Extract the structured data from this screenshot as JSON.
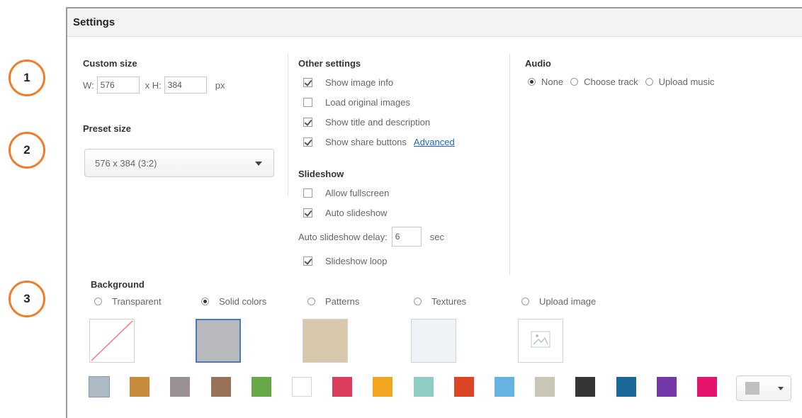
{
  "callouts": [
    "1",
    "2",
    "3"
  ],
  "panel": {
    "title": "Settings"
  },
  "custom_size": {
    "title": "Custom size",
    "w_label": "W:",
    "w_value": "576",
    "h_label": "x H:",
    "h_value": "384",
    "unit": "px"
  },
  "preset_size": {
    "title": "Preset size",
    "selected": "576 x 384 (3:2)"
  },
  "other_settings": {
    "title": "Other settings",
    "items": [
      {
        "label": "Show image info",
        "checked": true
      },
      {
        "label": "Load original images",
        "checked": false
      },
      {
        "label": "Show title and description",
        "checked": true
      },
      {
        "label": "Show share buttons",
        "checked": true
      }
    ],
    "advanced_link": "Advanced"
  },
  "slideshow": {
    "title": "Slideshow",
    "items": [
      {
        "label": "Allow fullscreen",
        "checked": false
      },
      {
        "label": "Auto slideshow",
        "checked": true
      }
    ],
    "delay_label": "Auto slideshow delay:",
    "delay_value": "6",
    "delay_unit": "sec",
    "loop": {
      "label": "Slideshow loop",
      "checked": true
    }
  },
  "audio": {
    "title": "Audio",
    "options": [
      {
        "label": "None",
        "selected": true
      },
      {
        "label": "Choose track",
        "selected": false
      },
      {
        "label": "Upload music",
        "selected": false
      }
    ]
  },
  "background": {
    "title": "Background",
    "options": [
      {
        "label": "Transparent",
        "selected": false
      },
      {
        "label": "Solid colors",
        "selected": true
      },
      {
        "label": "Patterns",
        "selected": false
      },
      {
        "label": "Textures",
        "selected": false
      },
      {
        "label": "Upload image",
        "selected": false
      }
    ],
    "swatches": [
      "#adb9c3",
      "#c88a3c",
      "#9a9197",
      "#98735a",
      "#69a848",
      "#ffffff",
      "#dc3d5c",
      "#f4a520",
      "#8ecdc4",
      "#dd4527",
      "#66b3e3",
      "#cac6b4",
      "#353535",
      "#1a6998",
      "#7438a8",
      "#e6156c"
    ],
    "custom_swatch_color": "#bfbfbf"
  }
}
